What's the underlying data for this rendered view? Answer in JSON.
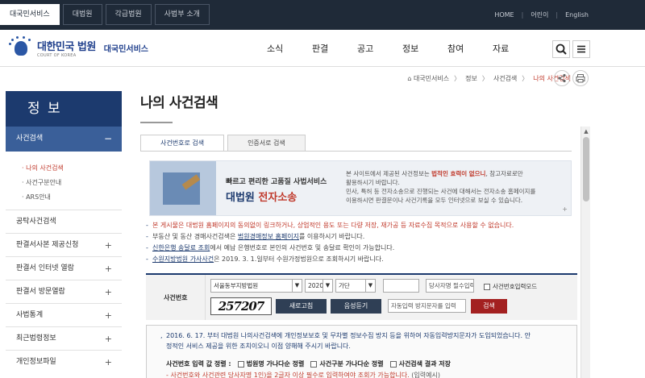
{
  "topbar": {
    "tabs": [
      "대국민서비스",
      "대법원",
      "각급법원",
      "사법부 소개"
    ],
    "links": [
      "HOME",
      "어린이",
      "English"
    ]
  },
  "header": {
    "logo_main": "대한민국 법원",
    "logo_sub": "COURT OF KOREA",
    "service_name": "대국민서비스",
    "menu": [
      "소식",
      "판결",
      "공고",
      "정보",
      "참여",
      "자료"
    ],
    "icons": [
      "search-icon",
      "menu-icon"
    ]
  },
  "breadcrumb": {
    "home_icon": "home-icon",
    "items": [
      "대국민서비스",
      "정보",
      "사건검색"
    ],
    "current": "나의 사건검색"
  },
  "tools": [
    "share-icon",
    "print-icon"
  ],
  "sidebar": {
    "title": "정 보",
    "section": "사건검색",
    "section_toggle": "−",
    "subitems": [
      "· 나의 사건검색",
      "· 사건구분안내",
      "· ARS안내"
    ],
    "items": [
      {
        "label": "공탁사건검색",
        "toggle": ""
      },
      {
        "label": "판결서사본 제공신청",
        "toggle": "+"
      },
      {
        "label": "판결서 인터넷 열람",
        "toggle": "+"
      },
      {
        "label": "판결서 방문열람",
        "toggle": "+"
      },
      {
        "label": "사법통계",
        "toggle": "+"
      },
      {
        "label": "최근법령정보",
        "toggle": "+"
      },
      {
        "label": "개인정보파일",
        "toggle": "+"
      }
    ]
  },
  "content": {
    "title": "나의 사건검색",
    "tabs": [
      "사건번호로 검색",
      "인증서로 검색"
    ],
    "banner": {
      "line1": "빠르고 편리한 고품질 사법서비스",
      "line2a": "대법원 ",
      "line2b": "전자소송",
      "right1a": "본 사이트에서 제공된 사건정보는 ",
      "right1b": "법적인 효력이 없으니",
      "right1c": ", 참고자료로만",
      "right2": "활용하시기 바랍니다.",
      "right3": "민사, 특허 등 전자소송으로 진행되는 사건에 대해서는 전자소송 홈페이지를",
      "right4": "이용하시면 판결문이나 사건기록을 모두 인터넷으로 보실 수 있습니다.",
      "plus": "+"
    },
    "notes": {
      "n1": "본 게시물은 대법원 홈페이지의 동의없이 링크하거나, 상업적인 용도 또는 다량 저장, 재가공 등 자료수집 목적으로 사용할 수 없습니다.",
      "n2a": "부동산 및 동산 경매사건검색은 ",
      "n2link": "법원경매정보 홈페이지",
      "n2b": "를 이용하시기 바랍니다.",
      "n3link": "신한은행 송달료 조회",
      "n3b": "에서 예납 은행번호로 본인의 사건번호 및 송달료 확인이 가능합니다.",
      "n4link": "수원지방법원 가사사건",
      "n4b": "은 2019. 3. 1.일부터 수원가정법원으로 조회하시기 바랍니다."
    },
    "search": {
      "label": "사건번호",
      "court": "서울동부지방법원",
      "year": "2020",
      "type": "가단",
      "number": "",
      "party_placeholder": "당사자명 필수입력",
      "save_checkbox": "사건번호입력모드",
      "captcha": "257207",
      "refresh_button": "새로고침",
      "audio_button": "음성듣기",
      "captcha_placeholder": "자동입력 방지문자를 입력",
      "search_button": "검색"
    },
    "info": {
      "line1": "2016. 6. 17. 부터 대법원 나의사건검색에 개인정보보호 및 무차별 정보수집 방지 등을 위하여 자동입력방지문자가 도입되었습니다. 안",
      "line2": "정적인 서비스 제공을 위한 조치이오니 이점 양해해 주시기 바랍니다.",
      "options_label": "사건번호 입력 값 정렬 :",
      "options": [
        "법원명 가나다순 정렬",
        "사건구분 가나다순 정렬",
        "사건검색 결과 저장"
      ],
      "red_text": "사건번호와 사건관련 당사자명 1인)을 2글자 이상 필수로 입력하여야 조회가 가능합니다.",
      "red_suffix": " (입력예시)"
    }
  }
}
